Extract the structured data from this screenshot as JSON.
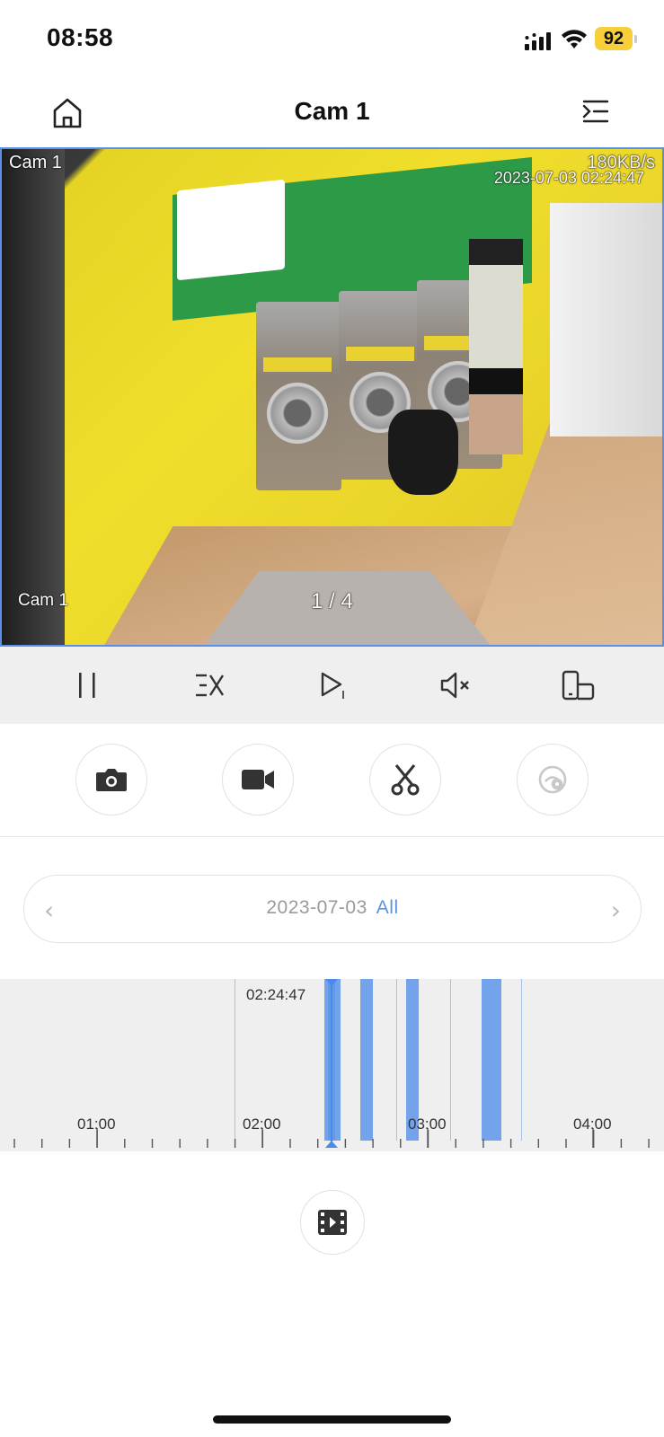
{
  "status_bar": {
    "time": "08:58",
    "battery": "92"
  },
  "nav": {
    "title": "Cam 1",
    "home_icon": "home-icon",
    "menu_icon": "menu-list-icon"
  },
  "video": {
    "camera_label_top": "Cam 1",
    "bitrate": "180KB/s",
    "timestamp": "2023-07-03 02:24:47",
    "camera_label_bottom": "Cam 1",
    "page_indicator": "1 / 4"
  },
  "controls": [
    {
      "name": "pause-button",
      "icon": "pause-icon"
    },
    {
      "name": "speed-button",
      "icon": "speed-x-icon"
    },
    {
      "name": "frame-step-button",
      "icon": "play-frame-icon"
    },
    {
      "name": "mute-button",
      "icon": "speaker-muted-icon"
    },
    {
      "name": "rotate-button",
      "icon": "rotate-screen-icon"
    }
  ],
  "actions": [
    {
      "name": "snapshot-button",
      "icon": "camera-icon"
    },
    {
      "name": "record-button",
      "icon": "video-camera-icon"
    },
    {
      "name": "clip-button",
      "icon": "scissors-icon"
    },
    {
      "name": "smart-detect-button",
      "icon": "eye-detect-icon",
      "disabled": true
    }
  ],
  "date_picker": {
    "date": "2023-07-03",
    "filter": "All"
  },
  "timeline": {
    "current_time": "02:24:47",
    "hour_labels": [
      "01:00",
      "02:00",
      "03:00",
      "04:00"
    ],
    "record_color": "#4a8ae8"
  },
  "colors": {
    "accent": "#5a93d9",
    "video_border": "#5b8fe8",
    "battery": "#f6cf3a"
  }
}
